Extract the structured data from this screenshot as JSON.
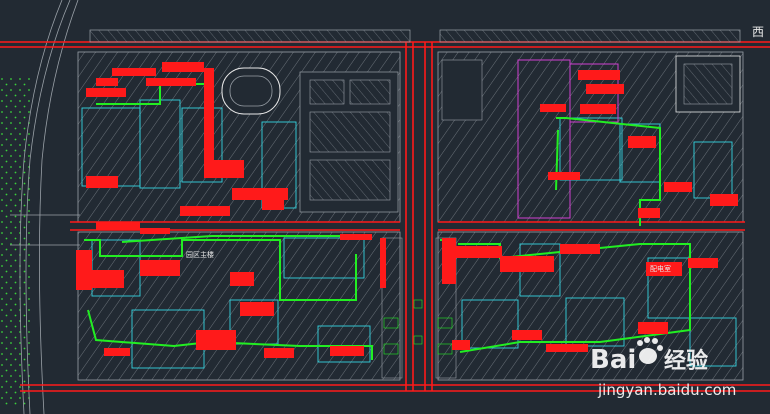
{
  "canvas": {
    "background": "#222a33",
    "colors": {
      "red": "#ff1a1a",
      "green": "#22ee22",
      "cyan": "#35d4e0",
      "white": "#e8e8e8",
      "gray": "#9aa1a8",
      "magenta": "#d040d0",
      "yellow": "#f0d020"
    }
  },
  "labels": {
    "corner_char": "西",
    "label_left": "园区主楼",
    "label_right": "配电室"
  },
  "watermark": {
    "brand_left": "Bai",
    "brand_right": "经验",
    "url": "jingyan.baidu.com",
    "icon": "baidu-paw-icon"
  }
}
